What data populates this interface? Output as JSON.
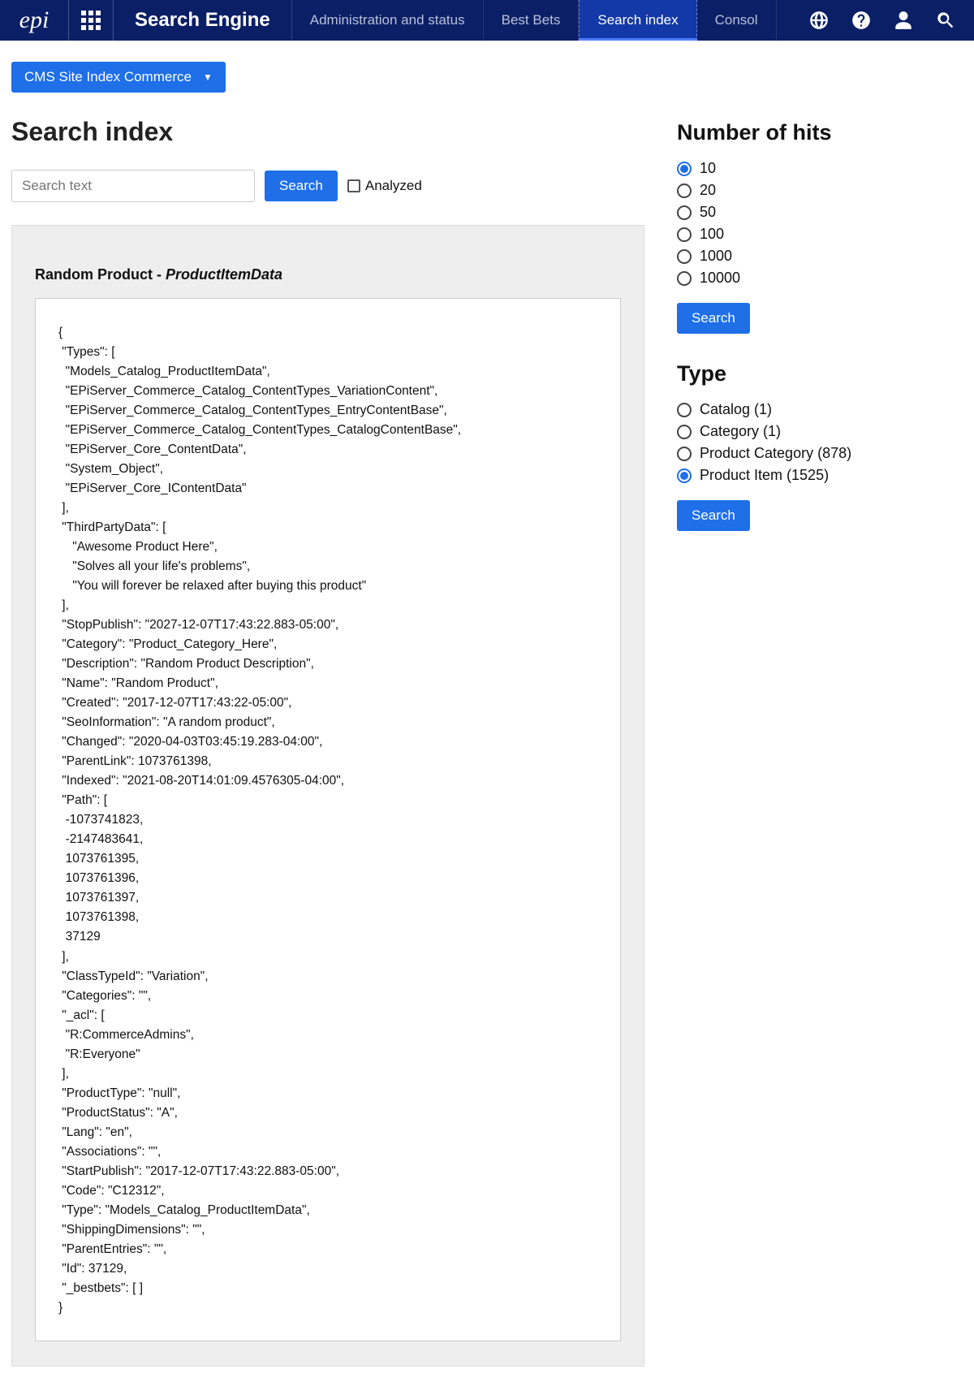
{
  "header": {
    "logo_text": "epi",
    "app_title": "Search Engine",
    "tabs": [
      {
        "label": "Administration and status"
      },
      {
        "label": "Best Bets"
      },
      {
        "label": "Search index"
      },
      {
        "label": "Consol"
      }
    ]
  },
  "subbar": {
    "index_selector_label": "CMS Site Index Commerce"
  },
  "page": {
    "title": "Search index",
    "search_placeholder": "Search text",
    "search_button_label": "Search",
    "analyzed_label": "Analyzed"
  },
  "result": {
    "title_prefix": "Random Product - ",
    "title_type": "ProductItemData",
    "json_text": "{\n \"Types\": [\n  \"Models_Catalog_ProductItemData\",\n  \"EPiServer_Commerce_Catalog_ContentTypes_VariationContent\",\n  \"EPiServer_Commerce_Catalog_ContentTypes_EntryContentBase\",\n  \"EPiServer_Commerce_Catalog_ContentTypes_CatalogContentBase\",\n  \"EPiServer_Core_ContentData\",\n  \"System_Object\",\n  \"EPiServer_Core_IContentData\"\n ],\n \"ThirdPartyData\": [\n    \"Awesome Product Here\",\n    \"Solves all your life's problems\",\n    \"You will forever be relaxed after buying this product\"\n ],\n \"StopPublish\": \"2027-12-07T17:43:22.883-05:00\",\n \"Category\": \"Product_Category_Here\",\n \"Description\": \"Random Product Description\",\n \"Name\": \"Random Product\",\n \"Created\": \"2017-12-07T17:43:22-05:00\",\n \"SeoInformation\": \"A random product\",\n \"Changed\": \"2020-04-03T03:45:19.283-04:00\",\n \"ParentLink\": 1073761398,\n \"Indexed\": \"2021-08-20T14:01:09.4576305-04:00\",\n \"Path\": [\n  -1073741823,\n  -2147483641,\n  1073761395,\n  1073761396,\n  1073761397,\n  1073761398,\n  37129\n ],\n \"ClassTypeId\": \"Variation\",\n \"Categories\": \"\",\n \"_acl\": [\n  \"R:CommerceAdmins\",\n  \"R:Everyone\"\n ],\n \"ProductType\": \"null\",\n \"ProductStatus\": \"A\",\n \"Lang\": \"en\",\n \"Associations\": \"\",\n \"StartPublish\": \"2017-12-07T17:43:22.883-05:00\",\n \"Code\": \"C12312\",\n \"Type\": \"Models_Catalog_ProductItemData\",\n \"ShippingDimensions\": \"\",\n \"ParentEntries\": \"\",\n \"Id\": 37129,\n \"_bestbets\": [ ]\n}"
  },
  "sidebar": {
    "hits_title": "Number of hits",
    "hits_options": [
      "10",
      "20",
      "50",
      "100",
      "1000",
      "10000"
    ],
    "hits_selected": "10",
    "search_button_label": "Search",
    "type_title": "Type",
    "type_options": [
      {
        "label": "Catalog (1)",
        "selected": false
      },
      {
        "label": "Category (1)",
        "selected": false
      },
      {
        "label": "Product Category (878)",
        "selected": false
      },
      {
        "label": "Product Item (1525)",
        "selected": true
      }
    ]
  }
}
